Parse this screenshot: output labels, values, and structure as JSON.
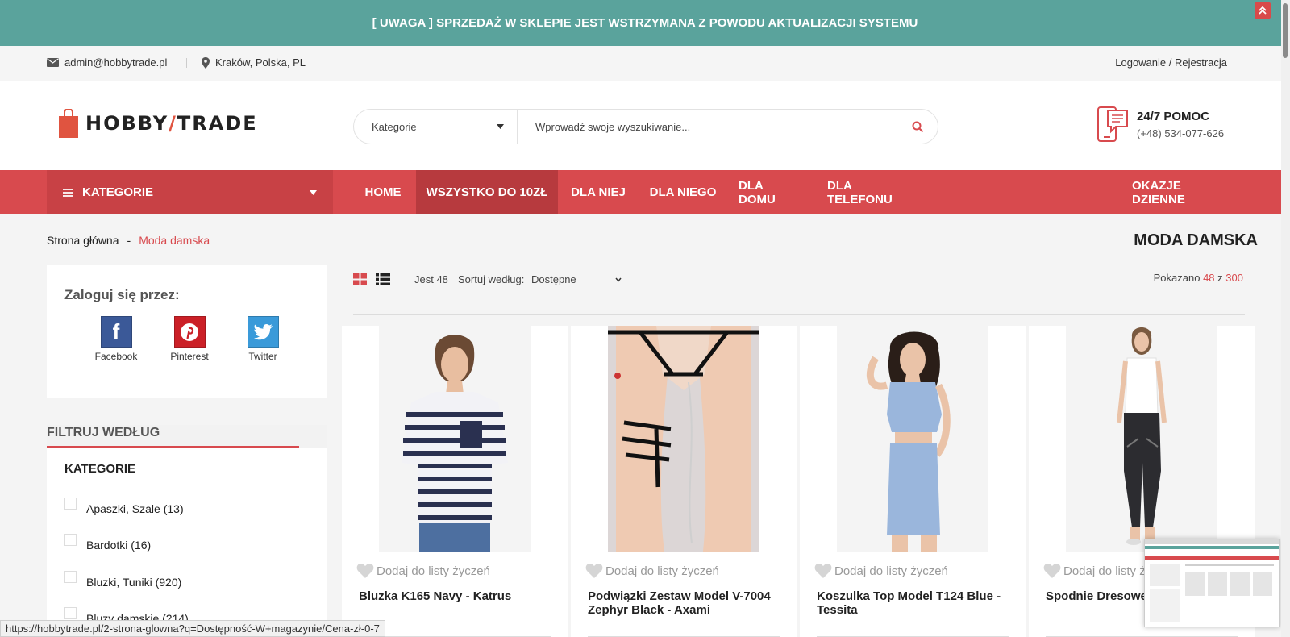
{
  "notice": {
    "text": "[ UWAGA ] SPRZEDAŻ W SKLEPIE JEST WSTRZYMANA Z POWODU AKTUALIZACJI SYSTEMU"
  },
  "topbar": {
    "email": "admin@hobbytrade.pl",
    "location": "Kraków, Polska, PL",
    "login": "Logowanie / Rejestracja"
  },
  "logo": {
    "part1": "HOBBY",
    "slash": "/",
    "part2": "TRADE"
  },
  "search": {
    "category": "Kategorie",
    "placeholder": "Wprowadź swoje wyszukiwanie..."
  },
  "help": {
    "title": "24/7 POMOC",
    "phone": "(+48) 534-077-626"
  },
  "nav": {
    "categories": "KATEGORIE",
    "links": [
      "HOME",
      "WSZYSTKO DO 10ZŁ",
      "DLA NIEJ",
      "DLA NIEGO",
      "DLA DOMU",
      "DLA TELEFONU"
    ],
    "deals": "OKAZJE DZIENNE"
  },
  "breadcrumb": {
    "home": "Strona główna",
    "sep": "-",
    "current": "Moda damska"
  },
  "page_title": "MODA DAMSKA",
  "login": {
    "title": "Zaloguj się przez:",
    "providers": [
      "Facebook",
      "Pinterest",
      "Twitter"
    ]
  },
  "filter": {
    "heading": "FILTRUJ WEDŁUG",
    "section": "KATEGORIE",
    "items": [
      "Apaszki, Szale (13)",
      "Bardotki (16)",
      "Bluzki, Tuniki (920)",
      "Bluzy damskie (214)"
    ]
  },
  "toolbar": {
    "per_page": "Jest 48",
    "sort_label": "Sortuj według:",
    "sort_value": "Dostępne",
    "shown_prefix": "Pokazano",
    "shown_count": "48",
    "shown_of": "z",
    "shown_total": "300"
  },
  "products": [
    {
      "wish": "Dodaj do listy życzeń",
      "title": "Bluzka K165 Navy - Katrus"
    },
    {
      "wish": "Dodaj do listy życzeń",
      "title": "Podwiązki Zestaw Model V-7004 Zephyr Black - Axami"
    },
    {
      "wish": "Dodaj do listy życzeń",
      "title": "Koszulka Top Model T124 Blue - Tessita"
    },
    {
      "wish": "Dodaj do listy życzeń",
      "title": "Spodnie Dresowe Black - Katrus"
    }
  ],
  "status_url": "https://hobbytrade.pl/2-strona-glowna?q=Dostępność-W+magazynie/Cena-zł-0-7",
  "colors": {
    "accent": "#d84a4e",
    "notice": "#5aa39c"
  }
}
